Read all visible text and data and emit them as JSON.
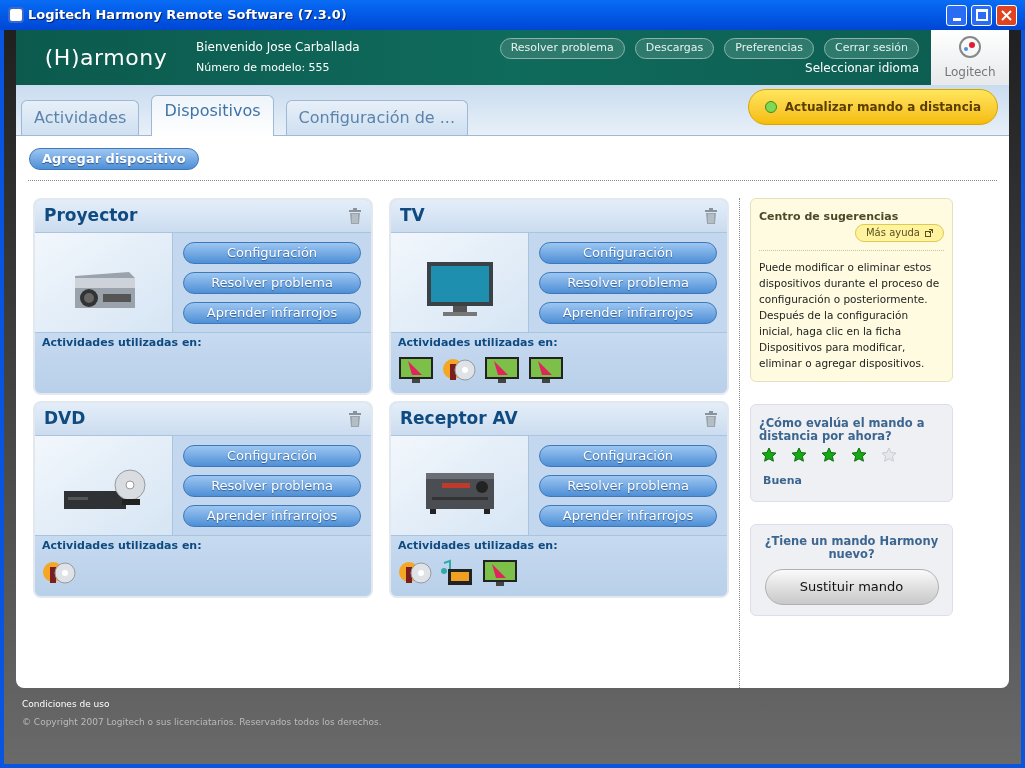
{
  "window": {
    "title": "Logitech Harmony Remote Software (7.3.0)"
  },
  "header": {
    "logo": "(H)armony",
    "welcome": "Bienvenido Jose Carballada",
    "model": "Número de modelo: 555",
    "links": [
      "Resolver problema",
      "Descargas",
      "Preferencias",
      "Cerrar sesión"
    ],
    "language": "Seleccionar idioma",
    "brand": "Logitech"
  },
  "tabs": [
    {
      "label": "Actividades",
      "selected": false
    },
    {
      "label": "Dispositivos",
      "selected": true
    },
    {
      "label": "Configuración de ...",
      "selected": false
    }
  ],
  "update_button": "Actualizar mando a distancia",
  "add_button": "Agregar dispositivo",
  "devices": [
    {
      "name": "Proyector",
      "kind": "projector",
      "buttons": [
        "Configuración",
        "Resolver problema",
        "Aprender infrarrojos"
      ],
      "activities_label": "Actividades utilizadas en:"
    },
    {
      "name": "TV",
      "kind": "tv",
      "buttons": [
        "Configuración",
        "Resolver problema",
        "Aprender infrarrojos"
      ],
      "activities_label": "Actividades utilizadas en:",
      "activities": [
        {
          "kind": "tv"
        },
        {
          "kind": "dvd"
        },
        {
          "kind": "tv"
        },
        {
          "kind": "tv"
        }
      ]
    },
    {
      "name": "DVD",
      "kind": "dvd",
      "buttons": [
        "Configuración",
        "Resolver problema",
        "Aprender infrarrojos"
      ],
      "activities_label": "Actividades utilizadas en:",
      "activities": [
        {
          "kind": "dvd"
        }
      ]
    },
    {
      "name": "Receptor AV",
      "kind": "receiver",
      "buttons": [
        "Configuración",
        "Resolver problema",
        "Aprender infrarrojos"
      ],
      "activities_label": "Actividades utilizadas en:",
      "activities": [
        {
          "kind": "dvd"
        },
        {
          "kind": "radio"
        },
        {
          "kind": "tv"
        }
      ]
    }
  ],
  "tips": {
    "title": "Centro de sugerencias",
    "help": "Más ayuda",
    "text": "Puede modificar o eliminar estos dispositivos durante el proceso de configuración o posteriormente. Después de la configuración inicial, haga clic en la ficha Dispositivos para modificar, eliminar o agregar dispositivos."
  },
  "rating": {
    "question": "¿Cómo evalúa el mando a distancia por ahora?",
    "stars": 4,
    "label": "Buena"
  },
  "replace": {
    "question": "¿Tiene un mando Harmony nuevo?",
    "button": "Sustituir mando"
  },
  "footer": {
    "terms": "Condiciones de uso",
    "copyright": "© Copyright 2007 Logitech o sus licenciatarios. Reservados todos los derechos."
  }
}
